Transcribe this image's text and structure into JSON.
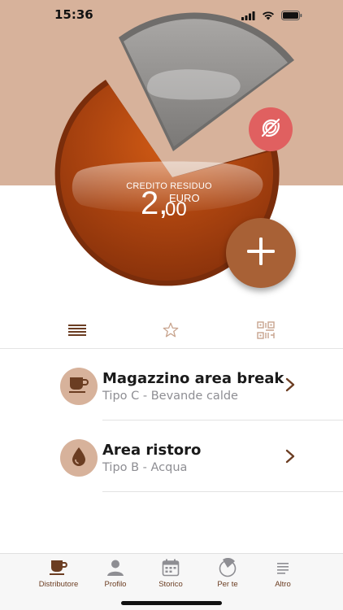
{
  "status_bar": {
    "time": "15:36",
    "icons": [
      "signal-icon",
      "wifi-icon",
      "battery-icon"
    ]
  },
  "colors": {
    "hero_bg": "#d7b29b",
    "pie_fill": "#a8420f",
    "pie_highlight": "#d05a14",
    "slice_gray": "#8e8c8a",
    "nfc_badge": "#e06060",
    "add_button": "#a86136",
    "accent_text": "#6b3d22"
  },
  "credit": {
    "label": "CREDITO RESIDUO",
    "integer": "2,",
    "decimal": "00",
    "currency": "EURO"
  },
  "nfc": {
    "icon": "nfc-disabled-icon"
  },
  "add_button": {
    "icon": "plus-icon"
  },
  "view_tabs": [
    {
      "name": "list",
      "icon": "list-icon",
      "active": true
    },
    {
      "name": "favorites",
      "icon": "star-icon",
      "active": false
    },
    {
      "name": "qr",
      "icon": "qr-code-icon",
      "active": false
    }
  ],
  "distributors": [
    {
      "title": "Magazzino area break",
      "subtitle": "Tipo C - Bevande calde",
      "icon": "coffee-cup-icon"
    },
    {
      "title": "Area ristoro",
      "subtitle": "Tipo B - Acqua",
      "icon": "water-drop-icon"
    }
  ],
  "bottom_nav": [
    {
      "label": "Distributore",
      "icon": "vending-cup-icon",
      "active": true
    },
    {
      "label": "Profilo",
      "icon": "person-icon",
      "active": false
    },
    {
      "label": "Storico",
      "icon": "calendar-icon",
      "active": false
    },
    {
      "label": "Per te",
      "icon": "pie-icon",
      "active": false
    },
    {
      "label": "Altro",
      "icon": "menu-lines-icon",
      "active": false
    }
  ]
}
